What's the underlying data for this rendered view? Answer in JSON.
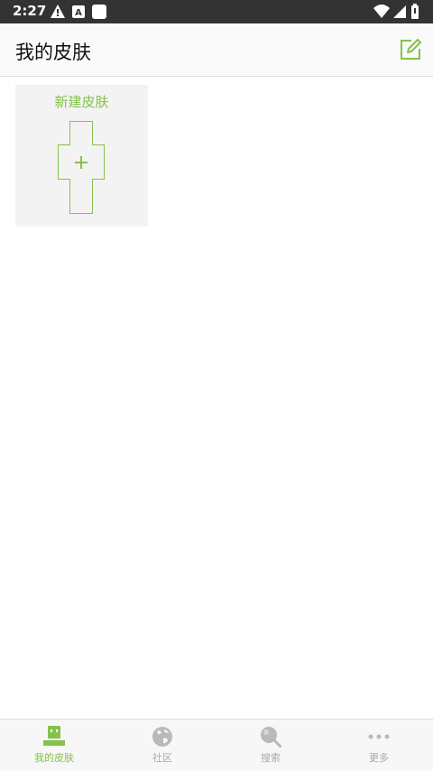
{
  "status_bar": {
    "time": "2:27",
    "left_icons": [
      "warning-icon",
      "a-icon",
      "square-icon"
    ],
    "right_icons": [
      "wifi-icon",
      "signal-icon",
      "battery-icon"
    ]
  },
  "header": {
    "title": "我的皮肤",
    "edit_icon": "edit-icon"
  },
  "main": {
    "new_skin_card": {
      "label": "新建皮肤",
      "icon": "plus-icon"
    }
  },
  "bottom_nav": {
    "items": [
      {
        "label": "我的皮肤",
        "icon": "robot-icon",
        "active": true
      },
      {
        "label": "社区",
        "icon": "globe-icon",
        "active": false
      },
      {
        "label": "搜索",
        "icon": "search-icon",
        "active": false
      },
      {
        "label": "更多",
        "icon": "more-icon",
        "active": false
      }
    ]
  },
  "colors": {
    "accent": "#84c24a",
    "inactive": "#b9b9b9",
    "status_bar": "#333333"
  }
}
